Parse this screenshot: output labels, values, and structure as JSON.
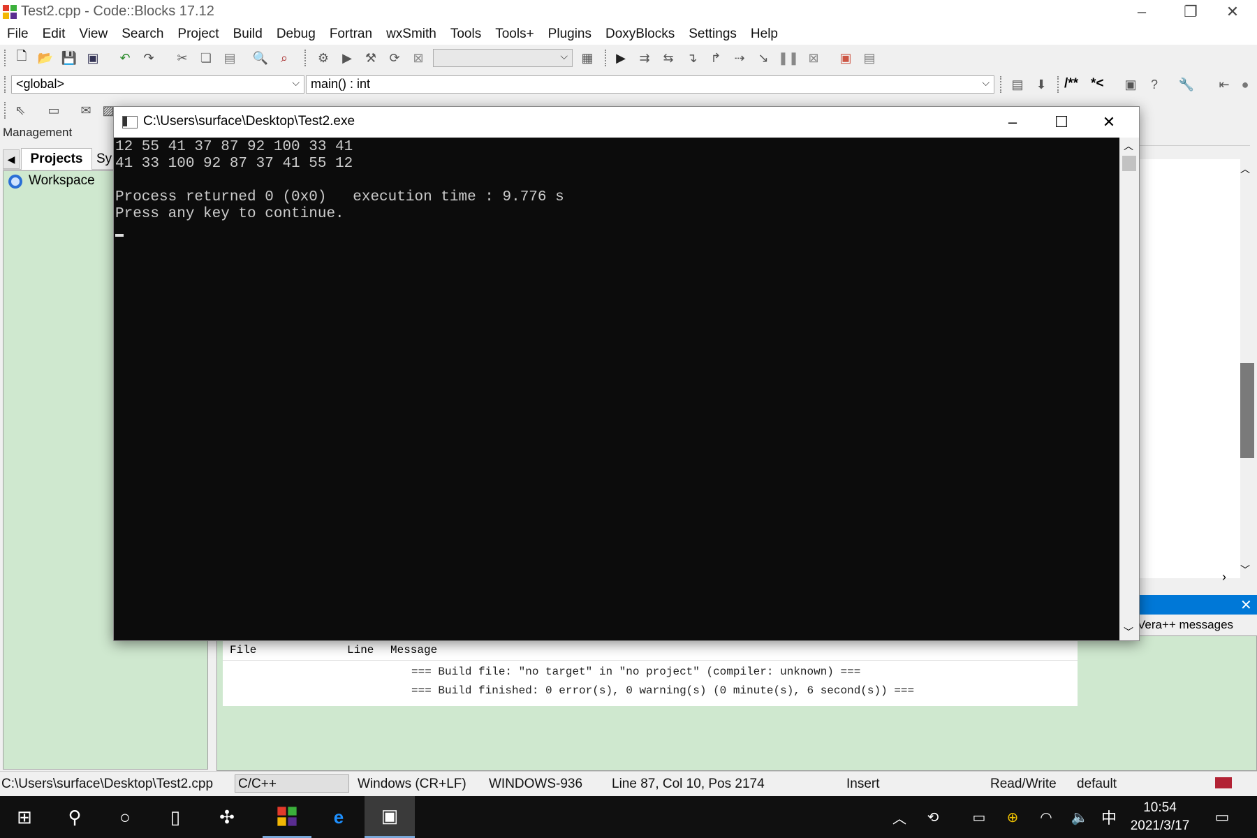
{
  "window": {
    "title": "Test2.cpp - Code::Blocks 17.12"
  },
  "menu": [
    "File",
    "Edit",
    "View",
    "Search",
    "Project",
    "Build",
    "Debug",
    "Fortran",
    "wxSmith",
    "Tools",
    "Tools+",
    "Plugins",
    "DoxyBlocks",
    "Settings",
    "Help"
  ],
  "code_nav": {
    "scope": "<global>",
    "symbol": "main() : int"
  },
  "doc_toolbar": {
    "comment_block": "/**",
    "comment_line": "*<"
  },
  "management": {
    "title": "Management",
    "tabs": [
      "Projects",
      "Sy"
    ],
    "workspace_label": "Workspace"
  },
  "console": {
    "title": "C:\\Users\\surface\\Desktop\\Test2.exe",
    "lines": [
      "12 55 41 37 87 92 100 33 41",
      "41 33 100 92 87 37 41 55 12",
      "",
      "Process returned 0 (0x0)   execution time : 9.776 s",
      "Press any key to continue."
    ]
  },
  "logs": {
    "tab_partial": "Vera++ messages",
    "columns": [
      "File",
      "Line",
      "Message"
    ],
    "messages": [
      "=== Build file: \"no target\" in \"no project\" (compiler: unknown) ===",
      "=== Build finished: 0 error(s), 0 warning(s) (0 minute(s), 6 second(s)) ==="
    ]
  },
  "statusbar": {
    "path": "C:\\Users\\surface\\Desktop\\Test2.cpp",
    "language": "C/C++",
    "eol": "Windows (CR+LF)",
    "encoding": "WINDOWS-936",
    "position": "Line 87, Col 10, Pos 2174",
    "mode": "Insert",
    "access": "Read/Write",
    "profile": "default"
  },
  "taskbar": {
    "ime": "中",
    "time": "10:54",
    "date": "2021/3/17"
  },
  "colors": {
    "console_bg": "#0c0c0c",
    "panel_green": "#cfe8cf",
    "accent": "#0078d7"
  }
}
